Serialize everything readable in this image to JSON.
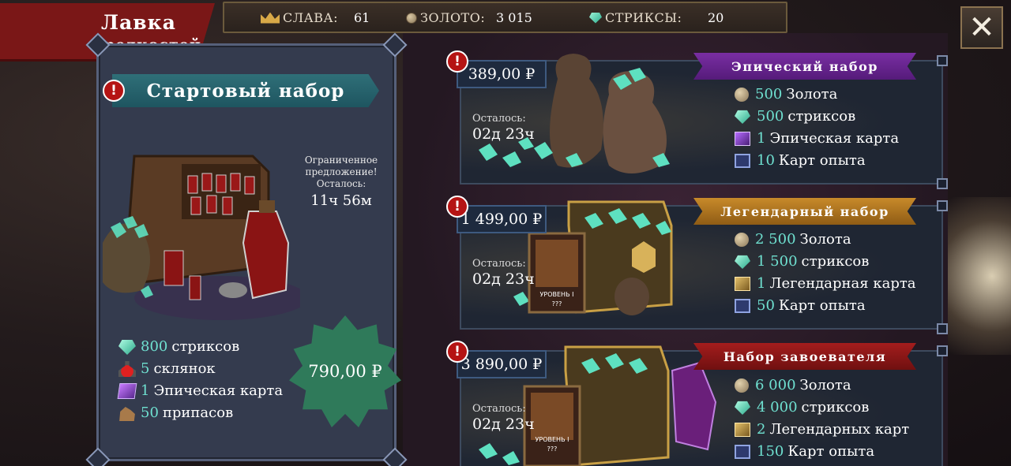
{
  "shop": {
    "title_line1": "Лавка",
    "title_line2": "редкостей"
  },
  "currency_bar": {
    "glory_label": "СЛАВА:",
    "glory_value": "61",
    "gold_label": "ЗОЛОТО:",
    "gold_value": "3 015",
    "strix_label": "СТРИКСЫ:",
    "strix_value": "20"
  },
  "close_button": {
    "icon": "close-icon",
    "glyph": "✕"
  },
  "starter_pack": {
    "title": "Стартовый набор",
    "alert": "!",
    "limited_line1": "Ограниченное",
    "limited_line2": "предложение!",
    "limited_line3": "Осталось:",
    "limited_time": "11ч 56м",
    "items": [
      {
        "num": "800",
        "text": "стриксов",
        "icon": "gem-icon"
      },
      {
        "num": "5",
        "text": "склянок",
        "icon": "potion-icon"
      },
      {
        "num": "1",
        "text": "Эпическая карта",
        "icon": "epic-card-icon"
      },
      {
        "num": "50",
        "text": "припасов",
        "icon": "supplies-icon"
      }
    ],
    "price": "790,00 ₽"
  },
  "offers": [
    {
      "name": "Эпический набор",
      "price": "389,00 ₽",
      "remaining_label": "Осталось:",
      "remaining_time": "02д 23ч",
      "alert": "!",
      "items": [
        {
          "num": "500",
          "text": "Золота",
          "icon": "coin-icon"
        },
        {
          "num": "500",
          "text": "стриксов",
          "icon": "gem-icon"
        },
        {
          "num": "1",
          "text": "Эпическая карта",
          "icon": "epic-card-icon"
        },
        {
          "num": "10",
          "text": "Карт опыта",
          "icon": "xp-card-icon"
        }
      ]
    },
    {
      "name": "Легендарный набор",
      "price": "1 499,00 ₽",
      "remaining_label": "Осталось:",
      "remaining_time": "02д 23ч",
      "alert": "!",
      "card_level": "УРОВЕНЬ I",
      "card_unknown": "???",
      "items": [
        {
          "num": "2 500",
          "text": "Золота",
          "icon": "coin-icon"
        },
        {
          "num": "1 500",
          "text": "стриксов",
          "icon": "gem-icon"
        },
        {
          "num": "1",
          "text": "Легендарная карта",
          "icon": "legendary-card-icon"
        },
        {
          "num": "50",
          "text": "Карт опыта",
          "icon": "xp-card-icon"
        }
      ]
    },
    {
      "name": "Набор завоевателя",
      "price": "3 890,00 ₽",
      "remaining_label": "Осталось:",
      "remaining_time": "02д 23ч",
      "alert": "!",
      "card_level": "УРОВЕНЬ I",
      "card_unknown": "???",
      "items": [
        {
          "num": "6 000",
          "text": "Золота",
          "icon": "coin-icon"
        },
        {
          "num": "4 000",
          "text": "стриксов",
          "icon": "gem-icon"
        },
        {
          "num": "2",
          "text": "Легендарных карт",
          "icon": "legendary-card-icon"
        },
        {
          "num": "150",
          "text": "Карт опыта",
          "icon": "xp-card-icon"
        }
      ]
    }
  ],
  "colors": {
    "accent_teal": "#6fe0d0",
    "epic_ribbon": "#7a2ea3",
    "legendary_ribbon": "#c88a2a",
    "conqueror_ribbon": "#a41d1d",
    "title_banner": "#7a1717"
  }
}
